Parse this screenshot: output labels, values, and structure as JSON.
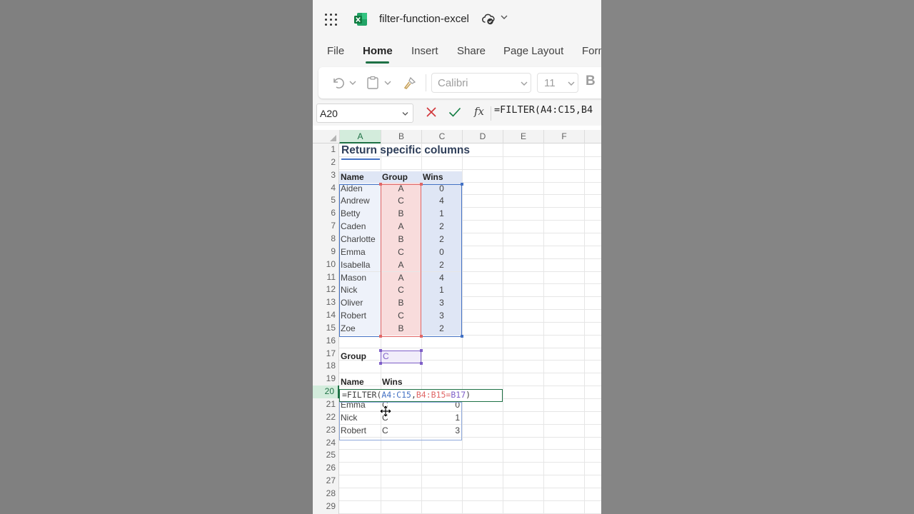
{
  "app": {
    "doc_title": "filter-function-excel"
  },
  "tabs": [
    "File",
    "Home",
    "Insert",
    "Share",
    "Page Layout",
    "Form"
  ],
  "ribbon": {
    "font_name": "Calibri",
    "font_size": "11",
    "bold_label": "B"
  },
  "formula_bar": {
    "name_box": "A20",
    "fx_label": "fx",
    "formula": "=FILTER(A4:C15,B4"
  },
  "columns": [
    "A",
    "B",
    "C",
    "D",
    "E",
    "F"
  ],
  "rows": [
    "1",
    "2",
    "3",
    "4",
    "5",
    "6",
    "7",
    "8",
    "9",
    "10",
    "11",
    "12",
    "13",
    "14",
    "15",
    "16",
    "17",
    "18",
    "19",
    "20",
    "21",
    "22",
    "23",
    "24",
    "25",
    "26",
    "27",
    "28",
    "29"
  ],
  "sheet": {
    "title": "Return specific columns",
    "table_headers": [
      "Name",
      "Group",
      "Wins"
    ],
    "table_rows": [
      {
        "name": "Aiden",
        "group": "A",
        "wins": "0"
      },
      {
        "name": "Andrew",
        "group": "C",
        "wins": "4"
      },
      {
        "name": "Betty",
        "group": "B",
        "wins": "1"
      },
      {
        "name": "Caden",
        "group": "A",
        "wins": "2"
      },
      {
        "name": "Charlotte",
        "group": "B",
        "wins": "2"
      },
      {
        "name": "Emma",
        "group": "C",
        "wins": "0"
      },
      {
        "name": "Isabella",
        "group": "A",
        "wins": "2"
      },
      {
        "name": "Mason",
        "group": "A",
        "wins": "4"
      },
      {
        "name": "Nick",
        "group": "C",
        "wins": "1"
      },
      {
        "name": "Oliver",
        "group": "B",
        "wins": "3"
      },
      {
        "name": "Robert",
        "group": "C",
        "wins": "3"
      },
      {
        "name": "Zoe",
        "group": "B",
        "wins": "2"
      }
    ],
    "criteria_label": "Group",
    "criteria_value": "C",
    "result_headers": [
      "Name",
      "Wins"
    ],
    "formula_parts": [
      "=FILTER(",
      "A4:C15",
      ",",
      "B4:B15",
      "=",
      "B17",
      ")"
    ],
    "result_rows": [
      {
        "name": "Emma",
        "group": "C",
        "wins": "0"
      },
      {
        "name": "Nick",
        "group": "C",
        "wins": "1"
      },
      {
        "name": "Robert",
        "group": "C",
        "wins": "3"
      }
    ]
  },
  "colors": {
    "accent": "#1e7145",
    "range_blue": "#4472c4",
    "range_red": "#e06666",
    "range_purple": "#7f5fc8"
  },
  "icons": [
    "app-launcher-icon",
    "excel-logo-icon",
    "autosave-cloud-icon",
    "chevron-down-icon",
    "undo-icon",
    "clipboard-icon",
    "format-painter-icon",
    "cancel-icon",
    "check-icon",
    "move-cursor-icon"
  ]
}
